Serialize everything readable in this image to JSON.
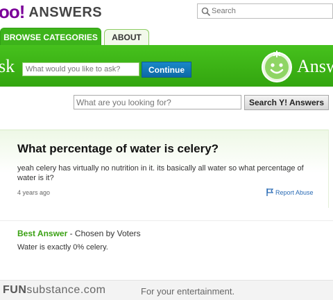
{
  "header": {
    "logo_text": "oo!",
    "logo_suffix": "ANSWERS",
    "search_placeholder": "Search"
  },
  "tabs": [
    {
      "label": "BROWSE CATEGORIES",
      "active": true
    },
    {
      "label": "ABOUT",
      "active": false
    }
  ],
  "askbar": {
    "ask_label": "sk",
    "input_placeholder": "What would you like to ask?",
    "continue_label": "Continue",
    "answers_label": "Answ"
  },
  "search": {
    "placeholder": "What are you looking for?",
    "button_label": "Search Y! Answers"
  },
  "question": {
    "title": "What percentage of water is celery?",
    "body": "yeah celery has virtually no nutrition in it. its basically all water so what percentage of water is it?",
    "time": "4 years ago",
    "report_label": "Report Abuse"
  },
  "best_answer": {
    "label": "Best Answer",
    "chosen_by": " - Chosen by Voters",
    "text": "Water is exactly 0% celery."
  },
  "footer": {
    "brand_prefix": "FUN",
    "brand_suffix": "substance.com",
    "tagline": "For your entertainment."
  },
  "colors": {
    "brand_purple": "#7b0099",
    "green": "#3db31b",
    "continue_blue": "#0d69a6",
    "link_blue": "#2a6bb5"
  },
  "icons": [
    "search-icon",
    "mascot-icon",
    "flag-icon"
  ]
}
